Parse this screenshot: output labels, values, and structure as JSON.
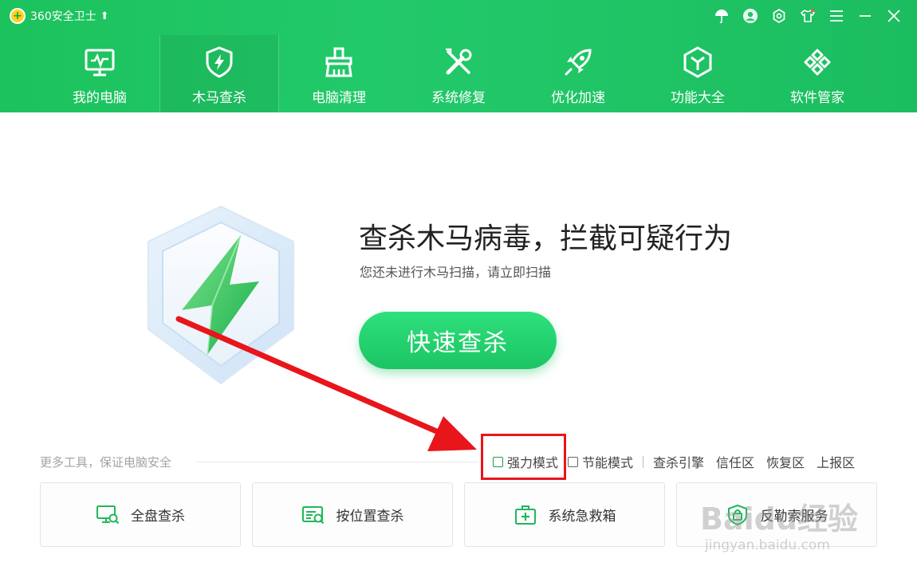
{
  "app": {
    "title": "360安全卫士"
  },
  "nav": [
    {
      "label": "我的电脑",
      "icon": "monitor-icon"
    },
    {
      "label": "木马查杀",
      "icon": "shield-bolt-icon",
      "active": true
    },
    {
      "label": "电脑清理",
      "icon": "broom-icon"
    },
    {
      "label": "系统修复",
      "icon": "tools-icon"
    },
    {
      "label": "优化加速",
      "icon": "rocket-icon"
    },
    {
      "label": "功能大全",
      "icon": "hexagon-icon"
    },
    {
      "label": "软件管家",
      "icon": "grid-flower-icon"
    }
  ],
  "hero": {
    "headline": "查杀木马病毒，拦截可疑行为",
    "subline": "您还未进行木马扫描，请立即扫描",
    "scan_button": "快速查杀"
  },
  "tools_row": {
    "caption": "更多工具，保证电脑安全",
    "options": {
      "power_mode": "强力模式",
      "eco_mode": "节能模式"
    },
    "links": [
      "查杀引擎",
      "信任区",
      "恢复区",
      "上报区"
    ]
  },
  "tool_cards": [
    {
      "label": "全盘查杀",
      "icon": "monitor-search-icon"
    },
    {
      "label": "按位置查杀",
      "icon": "folder-search-icon"
    },
    {
      "label": "系统急救箱",
      "icon": "first-aid-kit-icon"
    },
    {
      "label": "反勒索服务",
      "icon": "shield-lock-icon"
    }
  ],
  "watermark": {
    "brand": "Baidu经验",
    "url": "jingyan.baidu.com"
  },
  "colors": {
    "brand_green": "#1fc465",
    "highlight_red": "#e8151b",
    "arrow_red": "#e8151b"
  }
}
